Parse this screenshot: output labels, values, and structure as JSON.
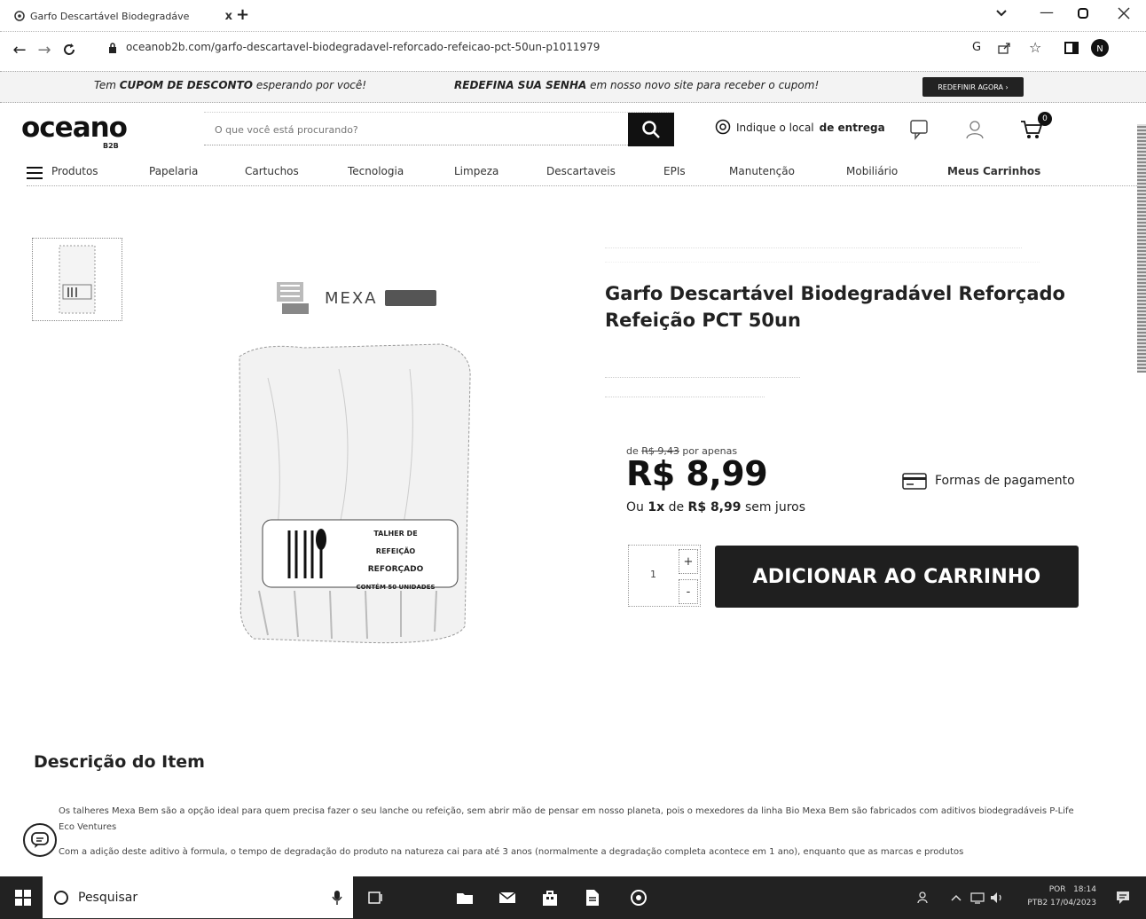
{
  "browser": {
    "tab_title": "Garfo Descartável Biodegradáve",
    "tab_close": "x",
    "new_tab": "+",
    "url": "oceanob2b.com/garfo-descartavel-biodegradavel-reforcado-refeicao-pct-50un-p1011979"
  },
  "promo": {
    "part1": "Tem",
    "part1_bold": "CUPOM DE DESCONTO",
    "part1_end": "esperando por você!",
    "part2_bold": "REDEFINA SUA SENHA",
    "part2_end": "em nosso novo site para receber o cupom!",
    "button": "REDEFINIR AGORA ›"
  },
  "header": {
    "logo": "oceano",
    "logo_sub": "B2B",
    "search_placeholder": "O que você está procurando?",
    "location_prefix": "Indique o local",
    "location_bold": "de entrega",
    "cart_count": "0"
  },
  "categories": [
    {
      "label": "Produtos"
    },
    {
      "label": "Papelaria"
    },
    {
      "label": "Cartuchos"
    },
    {
      "label": "Tecnologia"
    },
    {
      "label": "Limpeza"
    },
    {
      "label": "Descartaveis"
    },
    {
      "label": "EPIs"
    },
    {
      "label": "Manutenção"
    },
    {
      "label": "Mobiliário"
    },
    {
      "label": "Meus Carrinhos"
    }
  ],
  "product": {
    "brand": "MEXA",
    "package_line1": "TALHER DE REFEIÇÃO",
    "package_line2": "REFORÇADO",
    "package_line3": "CONTÉM 50 UNIDADES",
    "title": "Garfo Descartável Biodegradável Reforçado Refeição PCT 50un",
    "old_price_prefix": "de",
    "old_price": "R$ 9,43",
    "old_price_suffix": "por apenas",
    "price": "R$ 8,99",
    "installment_prefix": "Ou",
    "installment_count": "1x",
    "installment_mid": "de",
    "installment_value": "R$ 8,99",
    "installment_suffix": "sem juros",
    "payment_methods": "Formas de pagamento",
    "quantity": "1",
    "plus": "+",
    "minus": "-",
    "add_to_cart": "ADICIONAR AO CARRINHO"
  },
  "description": {
    "title": "Descrição do Item",
    "p1": "Os talheres Mexa Bem são a opção ideal para quem precisa fazer o seu lanche ou refeição, sem abrir mão de pensar em nosso planeta, pois o mexedores da linha Bio Mexa Bem são fabricados com aditivos biodegradáveis P-Life Eco Ventures",
    "p2": "Com a adição deste aditivo à formula, o tempo de degradação do produto na natureza cai para até 3 anos (normalmente a degradação completa acontece em 1 ano), enquanto que as marcas e produtos"
  },
  "taskbar": {
    "search": "Pesquisar",
    "lang1": "POR",
    "lang2": "PTB2",
    "time": "18:14",
    "date": "17/04/2023"
  }
}
